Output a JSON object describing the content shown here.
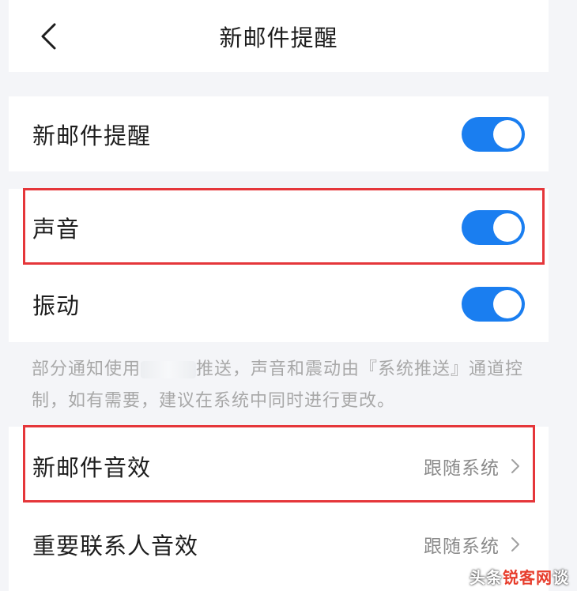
{
  "header": {
    "title": "新邮件提醒",
    "back_icon": "chevron-left-icon"
  },
  "settings": {
    "new_mail_alert": {
      "label": "新邮件提醒",
      "enabled": true
    },
    "sound": {
      "label": "声音",
      "enabled": true
    },
    "vibration": {
      "label": "振动",
      "enabled": true
    }
  },
  "hint": {
    "text_before": "部分通知使用",
    "text_after": "推送，声音和震动由『系统推送』通道控制，如有需要，建议在系统中同时进行更改。"
  },
  "sound_settings": {
    "new_mail_sound": {
      "label": "新邮件音效",
      "value": "跟随系统"
    },
    "important_contact_sound": {
      "label": "重要联系人音效",
      "value": "跟随系统"
    }
  },
  "watermark": {
    "prefix": "头条",
    "brand": "锐客网",
    "suffix": "谈"
  },
  "colors": {
    "accent": "#1a7ef0",
    "highlight_border": "#e5363a",
    "background": "#f4f5f8"
  }
}
